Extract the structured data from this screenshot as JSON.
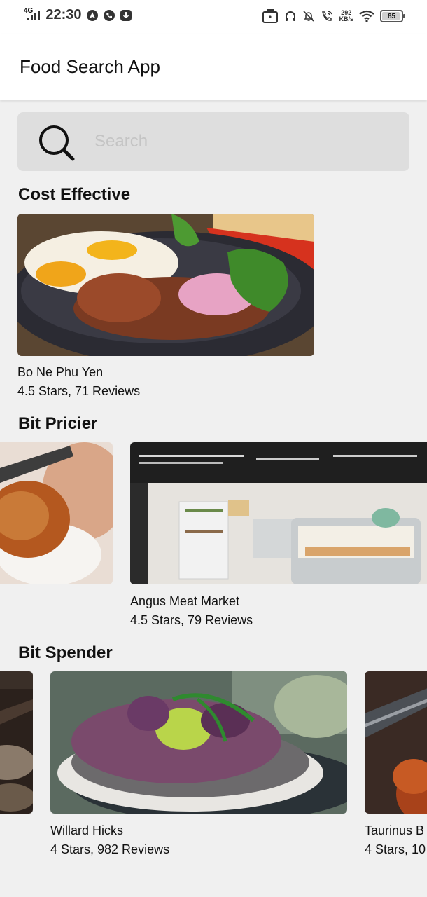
{
  "status_bar": {
    "network_type": "4G",
    "time": "22:30",
    "net_speed_value": "292",
    "net_speed_unit": "KB/s",
    "battery_level": "85"
  },
  "app": {
    "title": "Food Search App"
  },
  "search": {
    "placeholder": "Search",
    "value": ""
  },
  "sections": [
    {
      "title": "Cost Effective",
      "items": [
        {
          "name": "Bo Ne Phu Yen",
          "rating_text": "4.5 Stars, 71 Reviews"
        }
      ]
    },
    {
      "title": "Bit Pricier",
      "items": [
        {
          "name": "",
          "rating_text": ""
        },
        {
          "name": "Angus Meat Market",
          "rating_text": "4.5 Stars, 79 Reviews"
        }
      ]
    },
    {
      "title": "Bit Spender",
      "items": [
        {
          "name": "",
          "rating_text": ""
        },
        {
          "name": "Willard Hicks",
          "rating_text": "4 Stars, 982 Reviews"
        },
        {
          "name": "Taurinus B",
          "rating_text": "4 Stars, 10"
        }
      ]
    }
  ],
  "colors": {
    "background": "#f0f0f0",
    "app_bar": "#ffffff",
    "search_box": "#dedede",
    "placeholder": "#c4c4c4"
  }
}
